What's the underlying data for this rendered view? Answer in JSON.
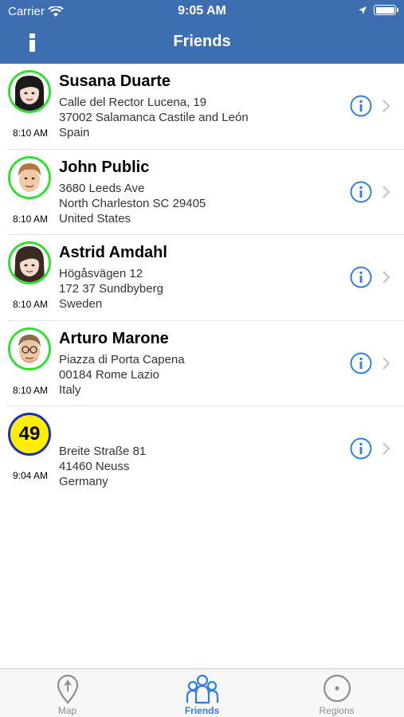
{
  "status_bar": {
    "carrier": "Carrier",
    "time": "9:05 AM"
  },
  "nav": {
    "title": "Friends",
    "info_icon": "info-icon"
  },
  "friends": [
    {
      "name": "Susana Duarte",
      "line1": "Calle del Rector Lucena, 19",
      "line2": "37002 Salamanca Castile and León",
      "line3": "Spain",
      "time": "8:10 AM",
      "avatar": "woman-avatar"
    },
    {
      "name": "John Public",
      "line1": "3680 Leeds Ave",
      "line2": "North Charleston SC 29405",
      "line3": "United States",
      "time": "8:10 AM",
      "avatar": "man-avatar"
    },
    {
      "name": "Astrid Amdahl",
      "line1": "Högåsvägen 12",
      "line2": "172 37 Sundbyberg",
      "line3": "Sweden",
      "time": "8:10 AM",
      "avatar": "woman-avatar"
    },
    {
      "name": "Arturo Marone",
      "line1": "Piazza di Porta Capena",
      "line2": "00184 Rome Lazio",
      "line3": "Italy",
      "time": "8:10 AM",
      "avatar": "man-glasses-avatar"
    },
    {
      "name": "",
      "badge": "49",
      "line1": "Breite Straße 81",
      "line2": "41460 Neuss",
      "line3": "Germany",
      "time": "9:04 AM",
      "avatar": "number-badge"
    }
  ],
  "tabs": [
    {
      "label": "Map",
      "icon": "map-pin-icon",
      "active": false
    },
    {
      "label": "Friends",
      "icon": "friends-icon",
      "active": true
    },
    {
      "label": "Regions",
      "icon": "regions-icon",
      "active": false
    }
  ],
  "colors": {
    "nav": "#3d6eb0",
    "accent": "#2f7ee0",
    "online_ring": "#2fe02f",
    "badge_fill": "#ffee00",
    "badge_ring": "#1c2fb8"
  }
}
